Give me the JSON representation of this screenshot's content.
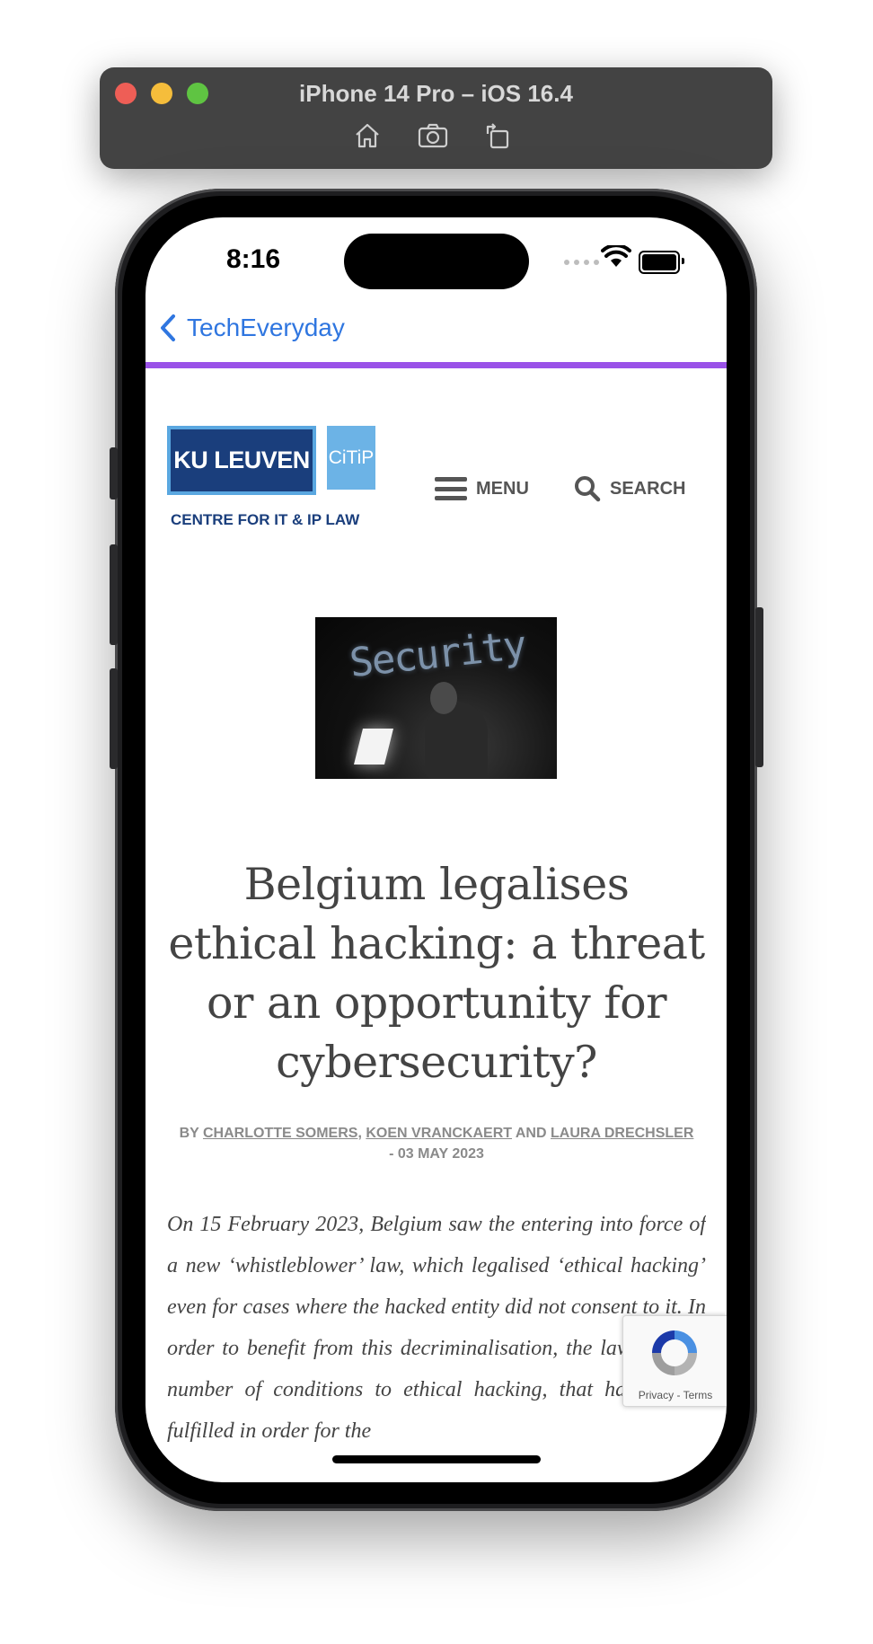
{
  "simulator": {
    "title": "iPhone 14 Pro – iOS 16.4",
    "tools": [
      "home-icon",
      "screenshot-icon",
      "rotate-icon"
    ]
  },
  "status_bar": {
    "time": "8:16"
  },
  "nav": {
    "back_label": "TechEveryday"
  },
  "site_header": {
    "logo_main": "KU LEUVEN",
    "logo_badge": "CiTiP",
    "logo_subtitle": "CENTRE FOR IT & IP LAW",
    "menu_label": "MENU",
    "search_label": "SEARCH"
  },
  "hero_image": {
    "overlay_text": "Security"
  },
  "article": {
    "title": "Belgium legalises ethical hacking: a threat or an opportunity for cybersecurity?",
    "byline_prefix": "BY",
    "authors": [
      "CHARLOTTE SOMERS",
      "KOEN VRANCKAERT",
      "LAURA DRECHSLER"
    ],
    "separator": ",",
    "and_word": "AND",
    "date": "- 03 MAY 2023",
    "body": "On 15 February 2023, Belgium saw the entering into force of a new ‘whistleblower’ law, which legalised ‘ethical hacking’ even for cases where the hacked entity did not consent to it. In order to benefit from this decriminalisation, the law poses a number of conditions to ethical hacking, that have to be fulfilled in order for the"
  },
  "recaptcha": {
    "privacy": "Privacy",
    "dash": "-",
    "terms": "Terms"
  },
  "colors": {
    "accent_purple": "#9a52e8",
    "link_blue": "#2f76e0",
    "logo_dark": "#1a3e7c",
    "logo_light": "#6cb3e6"
  }
}
